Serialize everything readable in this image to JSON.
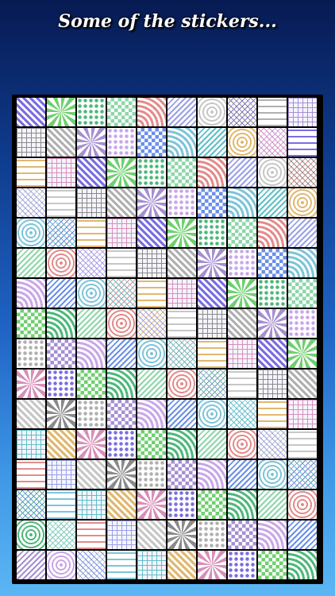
{
  "caption": "Some of the stickers...",
  "grid": {
    "columns": 10,
    "rows": 16
  },
  "palette": [
    "#7b6ee0",
    "#5fbfc6",
    "#c9a6e8",
    "#8a8a8a",
    "#e38b8b",
    "#6fcf6f",
    "#e0b870",
    "#6a8fe8",
    "#b0b0b0",
    "#9aa0e6",
    "#4db87a",
    "#d78fb8",
    "#7ec4d8",
    "#a58fd0",
    "#c7c7c7",
    "#8cd6a8"
  ],
  "motifs": [
    "diagonal-stripes",
    "checker",
    "concentric-rings",
    "grid-lines",
    "dots",
    "chevron",
    "squares",
    "radial",
    "waves",
    "crosshatch"
  ]
}
